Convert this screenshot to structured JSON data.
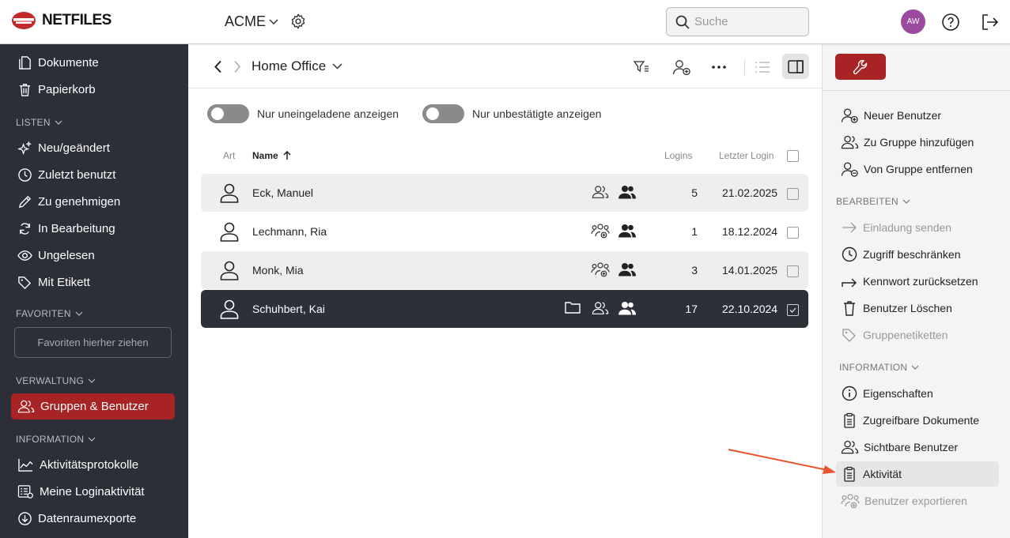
{
  "header": {
    "logo_text": "NETFILES",
    "tenant": "ACME",
    "search_placeholder": "Suche",
    "avatar_initials": "AW"
  },
  "sidebar": {
    "top_items": [
      {
        "label": "Dokumente",
        "icon": "document-icon"
      },
      {
        "label": "Papierkorb",
        "icon": "trash-icon"
      }
    ],
    "lists_header": "LISTEN",
    "list_items": [
      {
        "label": "Neu/geändert",
        "icon": "sparkle-icon"
      },
      {
        "label": "Zuletzt benutzt",
        "icon": "clock-icon"
      },
      {
        "label": "Zu genehmigen",
        "icon": "pencil-icon"
      },
      {
        "label": "In Bearbeitung",
        "icon": "refresh-icon"
      },
      {
        "label": "Ungelesen",
        "icon": "eye-icon"
      },
      {
        "label": "Mit Etikett",
        "icon": "tag-icon"
      }
    ],
    "favorites_header": "FAVORITEN",
    "favorites_placeholder": "Favoriten hierher ziehen",
    "admin_header": "VERWALTUNG",
    "admin_items": [
      {
        "label": "Gruppen & Benutzer",
        "icon": "users-icon",
        "active": true
      }
    ],
    "info_header": "INFORMATION",
    "info_items": [
      {
        "label": "Aktivitätsprotokolle",
        "icon": "chart-icon"
      },
      {
        "label": "Meine Loginaktivität",
        "icon": "list-icon"
      },
      {
        "label": "Datenraumexporte",
        "icon": "download-icon"
      }
    ]
  },
  "main": {
    "folder_title": "Home Office",
    "toggles": [
      {
        "label": "Nur uneingeladene anzeigen",
        "on": false
      },
      {
        "label": "Nur unbestätigte anzeigen",
        "on": false
      }
    ],
    "columns": {
      "type": "Art",
      "name": "Name",
      "logins": "Logins",
      "last_login": "Letzter Login"
    },
    "rows": [
      {
        "name": "Eck, Manuel",
        "logins": "5",
        "last_login": "21.02.2025",
        "selected": false
      },
      {
        "name": "Lechmann, Ria",
        "logins": "1",
        "last_login": "18.12.2024",
        "selected": false
      },
      {
        "name": "Monk, Mia",
        "logins": "3",
        "last_login": "14.01.2025",
        "selected": false
      },
      {
        "name": "Schuhbert, Kai",
        "logins": "17",
        "last_login": "22.10.2024",
        "selected": true
      }
    ]
  },
  "right_panel": {
    "top_items": [
      {
        "label": "Neuer Benutzer",
        "icon": "user-add-icon",
        "disabled": false
      },
      {
        "label": "Zu Gruppe hinzufügen",
        "icon": "group-icon",
        "disabled": false
      },
      {
        "label": "Von Gruppe entfernen",
        "icon": "user-remove-icon",
        "disabled": false
      }
    ],
    "edit_header": "BEARBEITEN",
    "edit_items": [
      {
        "label": "Einladung senden",
        "icon": "arrow-right-icon",
        "disabled": true
      },
      {
        "label": "Zugriff beschränken",
        "icon": "clock-icon",
        "disabled": false
      },
      {
        "label": "Kennwort zurücksetzen",
        "icon": "forward-icon",
        "disabled": false
      },
      {
        "label": "Benutzer Löschen",
        "icon": "trash-icon",
        "disabled": false
      },
      {
        "label": "Gruppenetiketten",
        "icon": "tag-icon",
        "disabled": true
      }
    ],
    "info_header": "INFORMATION",
    "info_items": [
      {
        "label": "Eigenschaften",
        "icon": "info-icon",
        "disabled": false
      },
      {
        "label": "Zugreifbare Dokumente",
        "icon": "clipboard-icon",
        "disabled": false
      },
      {
        "label": "Sichtbare Benutzer",
        "icon": "users-icon",
        "disabled": false
      },
      {
        "label": "Aktivität",
        "icon": "clipboard-icon",
        "disabled": false,
        "highlight": true
      },
      {
        "label": "Benutzer exportieren",
        "icon": "export-users-icon",
        "disabled": true
      }
    ]
  },
  "colors": {
    "brand_red": "#a82424",
    "sidebar_bg": "#2c2f38",
    "annotation_arrow": "#e8552f"
  }
}
